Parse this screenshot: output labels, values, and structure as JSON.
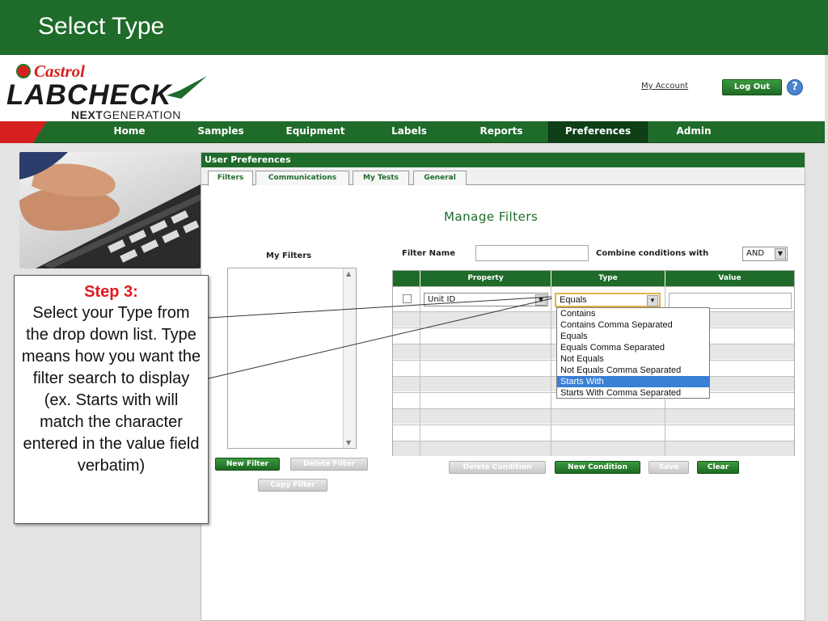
{
  "slide": {
    "title": "Select Type"
  },
  "header": {
    "castrol": "Castrol",
    "labcheck": "LABCHECK",
    "next": "NEXT",
    "generation": "GENERATION",
    "my_account": "My Account",
    "logout": "Log Out",
    "help": "?"
  },
  "nav": {
    "items": [
      "Home",
      "Samples",
      "Equipment",
      "Labels",
      "Reports",
      "Preferences",
      "Admin"
    ],
    "active": "Preferences"
  },
  "prefs": {
    "title": "User Preferences",
    "tabs": [
      "Filters",
      "Communications",
      "My Tests",
      "General"
    ],
    "active_tab": "Filters",
    "manage_title": "Manage Filters",
    "my_filters_label": "My Filters",
    "filter_name_label": "Filter Name",
    "filter_name_value": "",
    "combine_label": "Combine conditions with",
    "combine_value": "AND",
    "buttons": {
      "new_filter": "New Filter",
      "delete_filter": "Delete Filter",
      "copy_filter": "Copy Filter",
      "delete_condition": "Delete Condition",
      "new_condition": "New Condition",
      "save": "Save",
      "clear": "Clear"
    },
    "grid": {
      "columns": [
        "Property",
        "Type",
        "Value"
      ],
      "row": {
        "property": "Unit ID",
        "type": "Equals",
        "value": ""
      }
    },
    "type_options": [
      "Contains",
      "Contains Comma Separated",
      "Equals",
      "Equals Comma Separated",
      "Not Equals",
      "Not Equals Comma Separated",
      "Starts With",
      "Starts With Comma Separated"
    ],
    "highlighted_option": "Starts With"
  },
  "callout": {
    "title": "Step 3:",
    "body": "Select your Type from the drop down list.   Type means how you want the filter search to display (ex. Starts with will match the character entered in the value field verbatim)"
  },
  "colors": {
    "brand_green": "#1f6b2a",
    "castrol_red": "#d62020",
    "step_red": "#e0191f",
    "highlight_blue": "#3a7fd6"
  }
}
